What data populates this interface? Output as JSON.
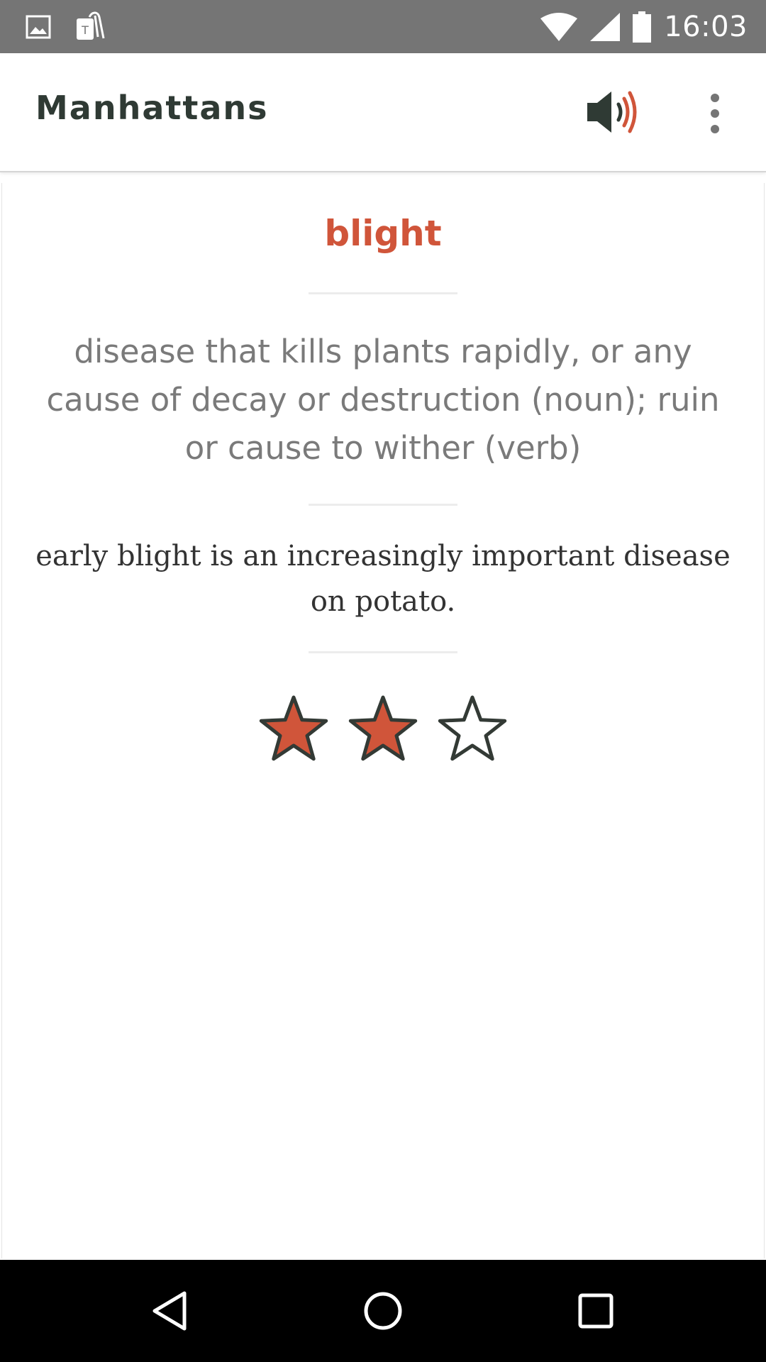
{
  "status_bar": {
    "time": "16:03",
    "icons": [
      "gallery-notification-icon",
      "tmobile-tag-icon",
      "wifi-icon",
      "cell-signal-icon",
      "battery-icon"
    ]
  },
  "app_bar": {
    "title": "Manhattans",
    "icons": [
      "speaker-icon",
      "more-vert-icon"
    ]
  },
  "card": {
    "word": "blight",
    "definition": "disease that kills plants rapidly, or any cause of decay or destruction (noun); ruin or cause to wither (verb)",
    "example": "early blight is an increasingly important disease on potato.",
    "rating": {
      "value": 2,
      "max": 3
    }
  },
  "nav_bar": {
    "icons": [
      "back-icon",
      "home-icon",
      "recents-icon"
    ]
  },
  "colors": {
    "accent": "#d0553a",
    "title_text": "#2f3a34",
    "definition_text": "#7a7a7a",
    "example_text": "#333333",
    "status_bar": "#757575",
    "nav_bar": "#000000"
  }
}
